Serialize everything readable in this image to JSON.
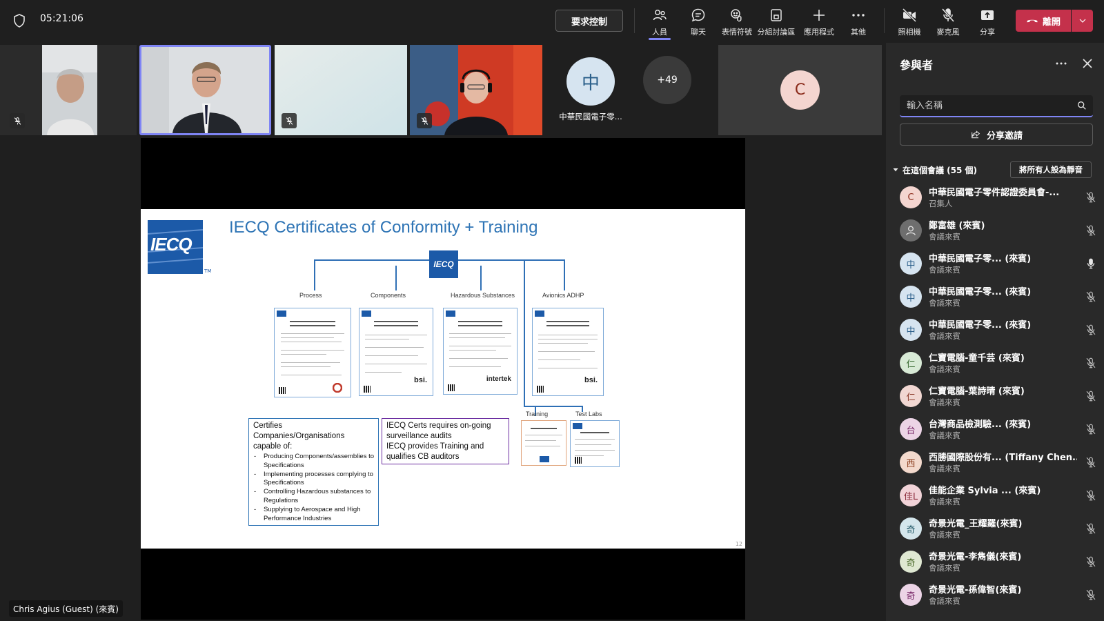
{
  "topbar": {
    "timer": "05:21:06",
    "request_control": "要求控制",
    "buttons": [
      {
        "label": "人員",
        "icon": "people-icon"
      },
      {
        "label": "聊天",
        "icon": "chat-icon"
      },
      {
        "label": "表情符號",
        "icon": "reaction-icon"
      },
      {
        "label": "分組討論區",
        "icon": "breakout-rooms-icon"
      },
      {
        "label": "應用程式",
        "icon": "add-apps-icon"
      },
      {
        "label": "其他",
        "icon": "more-icon"
      },
      {
        "label": "照相機",
        "icon": "camera-off-icon"
      },
      {
        "label": "麥克風",
        "icon": "mic-off-icon"
      },
      {
        "label": "分享",
        "icon": "share-tray-icon"
      }
    ],
    "leave": "離開"
  },
  "video_strip": {
    "group_tile_label": "中華民國電子零...",
    "group_tile_initial": "中",
    "overflow_count": "+49",
    "avatar_tile_initial": "C"
  },
  "slide": {
    "title": "IECQ Certificates of Conformity + Training",
    "logo_text": "IECQ",
    "categories": [
      "Process",
      "Components",
      "Hazardous Substances",
      "Avionics ADHP"
    ],
    "sub_categories": [
      "Training",
      "Test Labs"
    ],
    "certificate_brands": [
      "",
      "bsi.",
      "intertek",
      "bsi."
    ],
    "box1": {
      "heading": "Certifies Companies/Organisations capable of:",
      "items": [
        "Producing Components/assemblies to Specifications",
        "Implementing processes complying to Specifications",
        "Controlling Hazardous substances to Regulations",
        "Supplying to Aerospace and High Performance Industries"
      ]
    },
    "box2": {
      "line1": "IECQ Certs requires on-going surveillance audits",
      "line2": "IECQ provides Training and qualifies CB auditors"
    },
    "page_number": "12"
  },
  "presenter_name": "Chris Agius (Guest) (來賓)",
  "panel": {
    "title": "參與者",
    "search_placeholder": "輸入名稱",
    "share_invite": "分享邀請",
    "section_label": "在這個會議 (55 個)",
    "mute_all": "將所有人設為靜音",
    "participants": [
      {
        "initial": "C",
        "name": "中華民國電子零件認證委員會-...",
        "role": "召集人",
        "avatar_bg": "#f4d5d0",
        "avatar_fg": "#8a2a1a",
        "mic": "off"
      },
      {
        "initial": "",
        "name": "鄭富雄 (來賓)",
        "role": "會議來賓",
        "avatar_bg": "#6e6e6e",
        "avatar_fg": "#ffffff",
        "mic": "off"
      },
      {
        "initial": "中",
        "name": "中華民國電子零... (來賓)",
        "role": "會議來賓",
        "avatar_bg": "#d6e4f0",
        "avatar_fg": "#2b5f8a",
        "mic": "on"
      },
      {
        "initial": "中",
        "name": "中華民國電子零... (來賓)",
        "role": "會議來賓",
        "avatar_bg": "#d6e4f0",
        "avatar_fg": "#2b5f8a",
        "mic": "off"
      },
      {
        "initial": "中",
        "name": "中華民國電子零... (來賓)",
        "role": "會議來賓",
        "avatar_bg": "#d6e4f0",
        "avatar_fg": "#2b5f8a",
        "mic": "off"
      },
      {
        "initial": "仁",
        "name": "仁寶電腦-童千芸 (來賓)",
        "role": "會議來賓",
        "avatar_bg": "#d8ead6",
        "avatar_fg": "#3a6b33",
        "mic": "off"
      },
      {
        "initial": "仁",
        "name": "仁寶電腦-葉詩晴 (來賓)",
        "role": "會議來賓",
        "avatar_bg": "#f1d7d2",
        "avatar_fg": "#8a3a2a",
        "mic": "off"
      },
      {
        "initial": "台",
        "name": "台灣商品檢測驗... (來賓)",
        "role": "會議來賓",
        "avatar_bg": "#ecd4e6",
        "avatar_fg": "#7a2a6a",
        "mic": "off"
      },
      {
        "initial": "西",
        "name": "西勝國際股份有...  (Tiffany Chen...",
        "role": "會議來賓",
        "avatar_bg": "#f3d9cc",
        "avatar_fg": "#8a3a1a",
        "mic": "off"
      },
      {
        "initial": "佳L",
        "name": "佳能企業 Sylvia ... (來賓)",
        "role": "會議來賓",
        "avatar_bg": "#f1d3d8",
        "avatar_fg": "#8a2a3a",
        "mic": "off"
      },
      {
        "initial": "奇",
        "name": "奇景光電_王耀羅(來賓)",
        "role": "會議來賓",
        "avatar_bg": "#d4e6ec",
        "avatar_fg": "#2a5f6e",
        "mic": "off"
      },
      {
        "initial": "奇",
        "name": "奇景光電-李雋儀(來賓)",
        "role": "會議來賓",
        "avatar_bg": "#dfe8d2",
        "avatar_fg": "#4a6a2a",
        "mic": "off"
      },
      {
        "initial": "奇",
        "name": "奇景光電-孫偉智(來賓)",
        "role": "會議來賓",
        "avatar_bg": "#ecd4e6",
        "avatar_fg": "#7a2a6a",
        "mic": "off"
      }
    ]
  },
  "colors": {
    "accent": "#7f85f5",
    "leave_red": "#c4314b",
    "slide_title_blue": "#2e74b5",
    "iecq_blue": "#1c5aa8"
  }
}
